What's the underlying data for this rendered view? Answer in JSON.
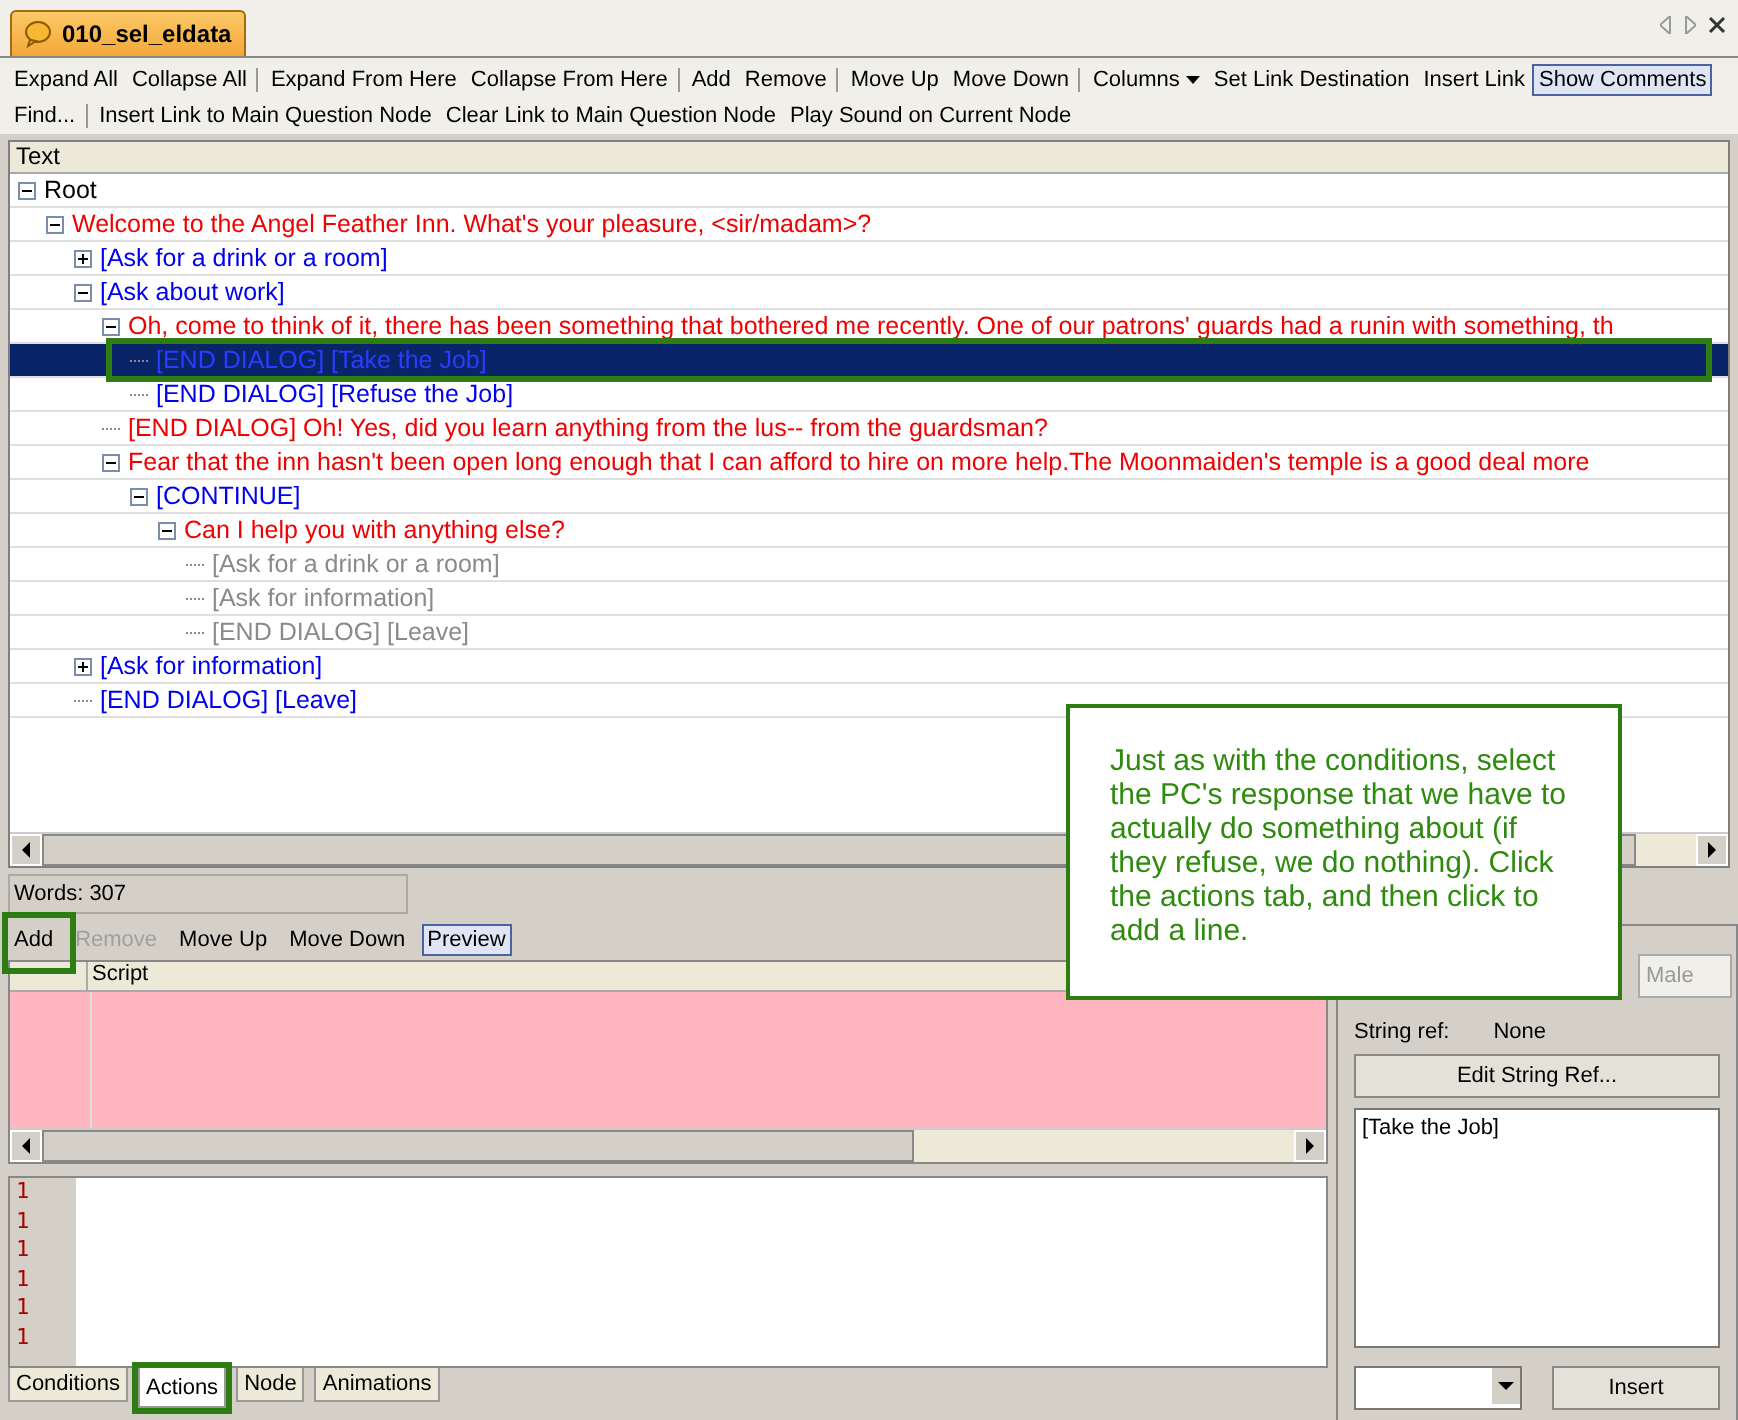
{
  "document_tab": {
    "title": "010_sel_eldata"
  },
  "toolbar_1": [
    {
      "label": "Expand All",
      "pressed": false,
      "sep": false
    },
    {
      "label": "Collapse All",
      "pressed": false,
      "sep": true
    },
    {
      "label": "Expand From Here",
      "pressed": false,
      "sep": false
    },
    {
      "label": "Collapse From Here",
      "pressed": false,
      "sep": true
    },
    {
      "label": "Add",
      "pressed": false,
      "sep": false
    },
    {
      "label": "Remove",
      "pressed": false,
      "sep": true
    },
    {
      "label": "Move Up",
      "pressed": false,
      "sep": false
    },
    {
      "label": "Move Down",
      "pressed": false,
      "sep": true
    },
    {
      "label": "Columns",
      "pressed": false,
      "sep": false,
      "dropdown": true
    },
    {
      "label": "Set Link Destination",
      "pressed": false,
      "sep": false
    },
    {
      "label": "Insert Link",
      "pressed": false,
      "sep": false
    },
    {
      "label": "Show Comments",
      "pressed": true,
      "sep": false
    }
  ],
  "toolbar_2": [
    {
      "label": "Find...",
      "pressed": false,
      "sep": true
    },
    {
      "label": "Insert Link to Main Question Node",
      "pressed": false,
      "sep": false
    },
    {
      "label": "Clear Link to Main Question Node",
      "pressed": false,
      "sep": false
    },
    {
      "label": "Play Sound on Current Node",
      "pressed": false,
      "sep": false
    }
  ],
  "tree": {
    "column": "Text",
    "nodes": [
      {
        "text": "Root",
        "kind": "root",
        "expanded": true,
        "selected": false,
        "children": [
          {
            "text": "Welcome to the Angel Feather Inn. What's your pleasure, <sir/madam>?",
            "kind": "npc",
            "expanded": true,
            "selected": false,
            "children": [
              {
                "text": "[Ask for a drink or a room]",
                "kind": "pc",
                "expanded": false,
                "selected": false
              },
              {
                "text": "[Ask about work]",
                "kind": "pc",
                "expanded": true,
                "selected": false,
                "children": [
                  {
                    "text": "Oh, come to think of it, there has been something that bothered me recently. One of our patrons' guards had a runin with something, th",
                    "kind": "npc",
                    "expanded": true,
                    "selected": false,
                    "children": [
                      {
                        "text": "[END DIALOG] [Take the Job]",
                        "kind": "pc",
                        "selected": true
                      },
                      {
                        "text": "[END DIALOG] [Refuse the Job]",
                        "kind": "pc",
                        "selected": false
                      }
                    ]
                  },
                  {
                    "text": "[END DIALOG] Oh! Yes, did you learn anything from the lus-- from the guardsman?",
                    "kind": "npc",
                    "selected": false
                  },
                  {
                    "text": "Fear that the inn hasn't been open long enough that I can afford to hire on more help.The Moonmaiden's temple is a good deal more",
                    "kind": "npc",
                    "expanded": true,
                    "selected": false,
                    "children": [
                      {
                        "text": "[CONTINUE]",
                        "kind": "pc",
                        "expanded": true,
                        "selected": false,
                        "children": [
                          {
                            "text": "Can I help you with anything else?",
                            "kind": "npc",
                            "expanded": true,
                            "selected": false,
                            "children": [
                              {
                                "text": "[Ask for a drink or a room]",
                                "kind": "link",
                                "selected": false
                              },
                              {
                                "text": "[Ask for information]",
                                "kind": "link",
                                "selected": false
                              },
                              {
                                "text": "[END DIALOG] [Leave]",
                                "kind": "link",
                                "selected": false
                              }
                            ]
                          }
                        ]
                      }
                    ]
                  }
                ]
              },
              {
                "text": "[Ask for information]",
                "kind": "pc",
                "expanded": false,
                "selected": false
              },
              {
                "text": "[END DIALOG] [Leave]",
                "kind": "pc",
                "selected": false
              }
            ]
          }
        ]
      }
    ]
  },
  "word_count": "Words: 307",
  "actions_toolbar": [
    {
      "label": "Add",
      "disabled": false,
      "pressed": false
    },
    {
      "label": "Remove",
      "disabled": true,
      "pressed": false
    },
    {
      "label": "Move Up",
      "disabled": false,
      "pressed": false
    },
    {
      "label": "Move Down",
      "disabled": false,
      "pressed": false
    },
    {
      "label": "Preview",
      "disabled": false,
      "pressed": true
    }
  ],
  "script_grid": {
    "columns": [
      "Script"
    ]
  },
  "line_numbers": [
    "1",
    "1",
    "1",
    "1",
    "1",
    "1"
  ],
  "bottom_tabs": [
    {
      "label": "Conditions",
      "selected": false
    },
    {
      "label": "Actions",
      "selected": true
    },
    {
      "label": "Node",
      "selected": false
    },
    {
      "label": "Animations",
      "selected": false
    }
  ],
  "right_panel": {
    "gender_field": "Male",
    "string_ref_label": "String ref:",
    "string_ref_value": "None",
    "edit_button": "Edit String Ref...",
    "text": "[Take the Job]",
    "insert_button": "Insert"
  },
  "callout": {
    "text": "Just as with the conditions, select the PC's response that we have to actually do something about (if they refuse, we do nothing). Click the actions tab, and then click to add a line."
  }
}
